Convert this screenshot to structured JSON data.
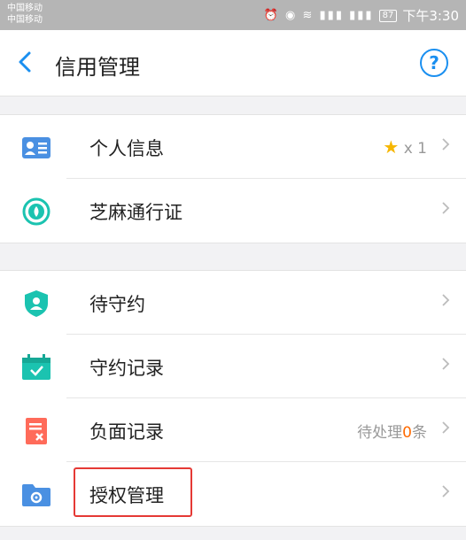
{
  "status_bar": {
    "carrier_1": "中国移动",
    "carrier_2": "中国移动",
    "battery": "87",
    "time": "下午3:30"
  },
  "header": {
    "title": "信用管理",
    "back_icon": "chevron-left-icon",
    "help_label": "?"
  },
  "sections": [
    {
      "items": [
        {
          "label": "个人信息",
          "icon": "id-card-icon",
          "star": "★",
          "extra": "x 1"
        },
        {
          "label": "芝麻通行证",
          "icon": "sesame-icon"
        }
      ]
    },
    {
      "items": [
        {
          "label": "待守约",
          "icon": "shield-person-icon"
        },
        {
          "label": "守约记录",
          "icon": "calendar-check-icon"
        },
        {
          "label": "负面记录",
          "icon": "document-x-icon",
          "extra_prefix": "待处理",
          "extra_count": "0",
          "extra_suffix": "条"
        },
        {
          "label": "授权管理",
          "icon": "folder-gear-icon"
        }
      ]
    }
  ],
  "colors": {
    "accent": "#1a8ff0",
    "teal": "#1bc3b0",
    "negative": "#ff6b5a",
    "highlight_border": "#e53935",
    "count_highlight": "#ff6a00"
  }
}
